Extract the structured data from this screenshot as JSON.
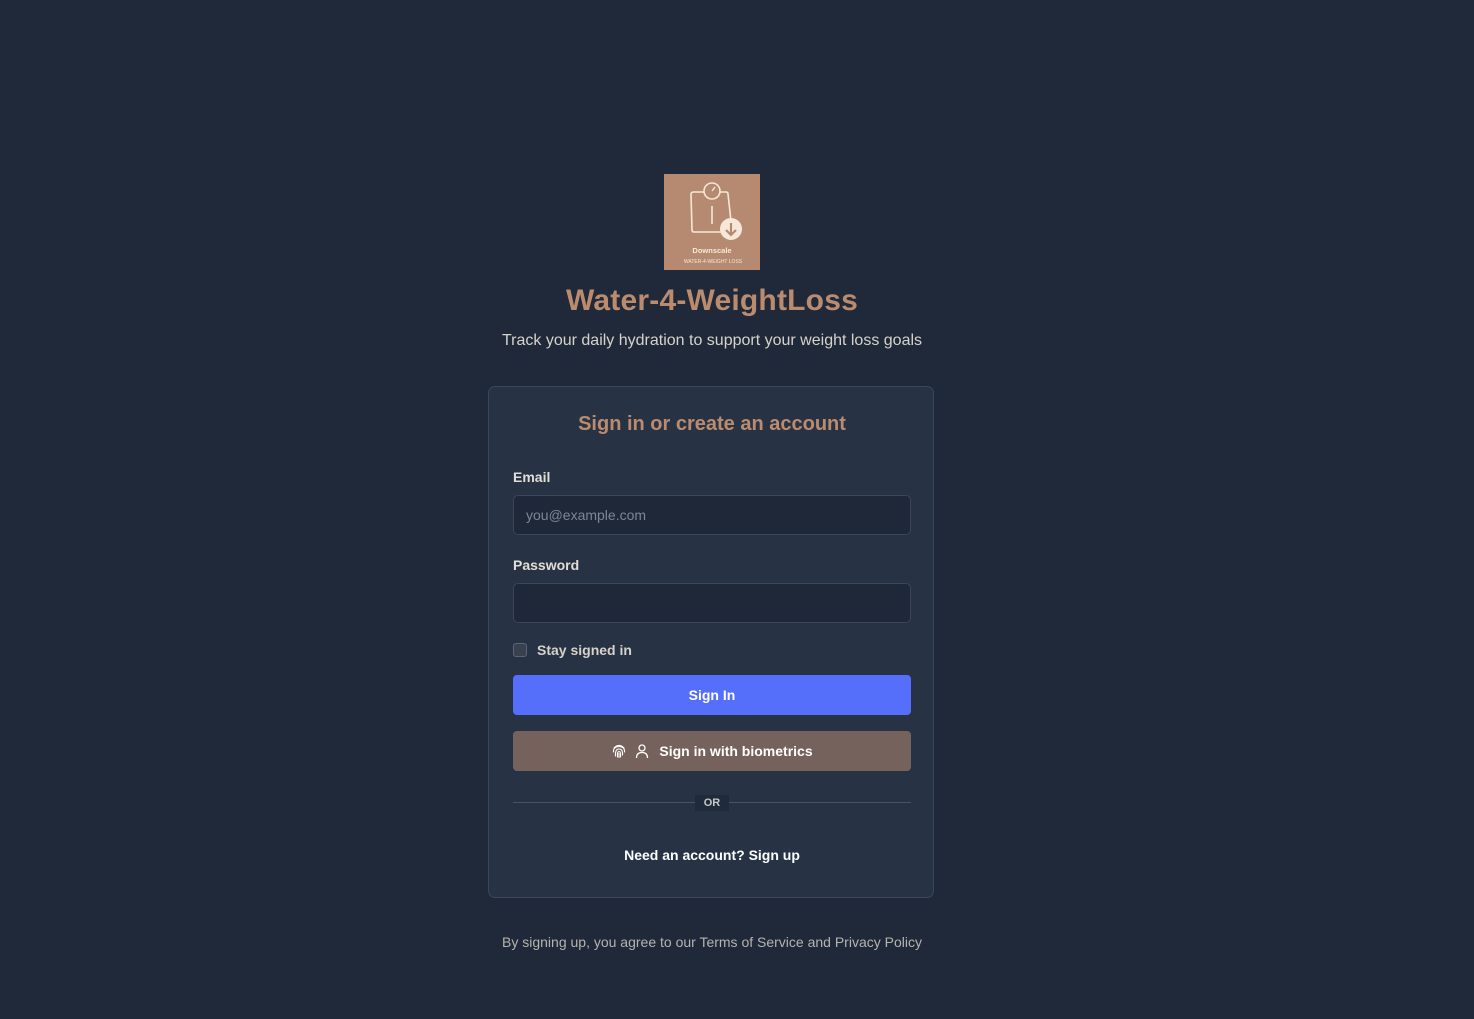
{
  "brand": {
    "logo_text": "Downscale",
    "logo_subtext": "WATER-4-WEIGHT LOSS",
    "logo_icon": "scale-down-arrow-icon",
    "title": "Water-4-WeightLoss",
    "subtitle": "Track your daily hydration to support your weight loss goals"
  },
  "card": {
    "title": "Sign in or create an account",
    "email_label": "Email",
    "email_placeholder": "you@example.com",
    "email_value": "",
    "password_label": "Password",
    "password_value": "",
    "stay_signed_in_label": "Stay signed in",
    "stay_signed_in_checked": false,
    "sign_in_label": "Sign In",
    "biometric_label": "Sign in with biometrics",
    "biometric_icons": [
      "fingerprint-icon",
      "user-icon"
    ],
    "divider_text": "OR",
    "signup_text": "Need an account? Sign up"
  },
  "footer": {
    "agreement_text": "By signing up, you agree to our Terms of Service and Privacy Policy"
  },
  "colors": {
    "background": "#1f293a",
    "card_background": "#273345",
    "accent": "#bb8b6e",
    "primary_button": "#556ffa",
    "biometric_button": "#76625c",
    "logo_background": "#b68a71"
  }
}
